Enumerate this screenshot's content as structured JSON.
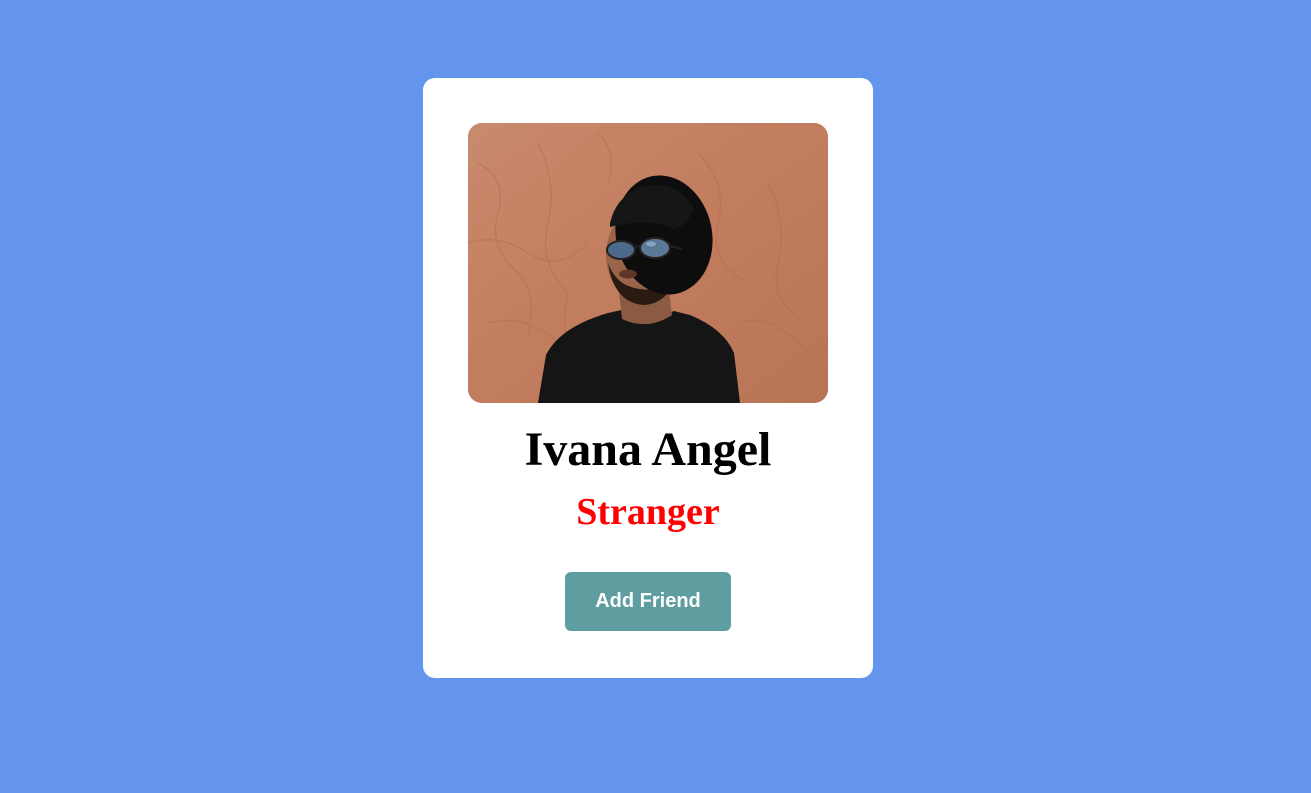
{
  "card": {
    "photo_alt": "Profile photo",
    "name": "Ivana Angel",
    "status": "Stranger",
    "button_label": "Add Friend"
  },
  "colors": {
    "page_background": "#6495ed",
    "card_background": "#ffffff",
    "status_text": "#ff0000",
    "button_background": "#5f9ea0",
    "button_text": "#ffffff"
  }
}
